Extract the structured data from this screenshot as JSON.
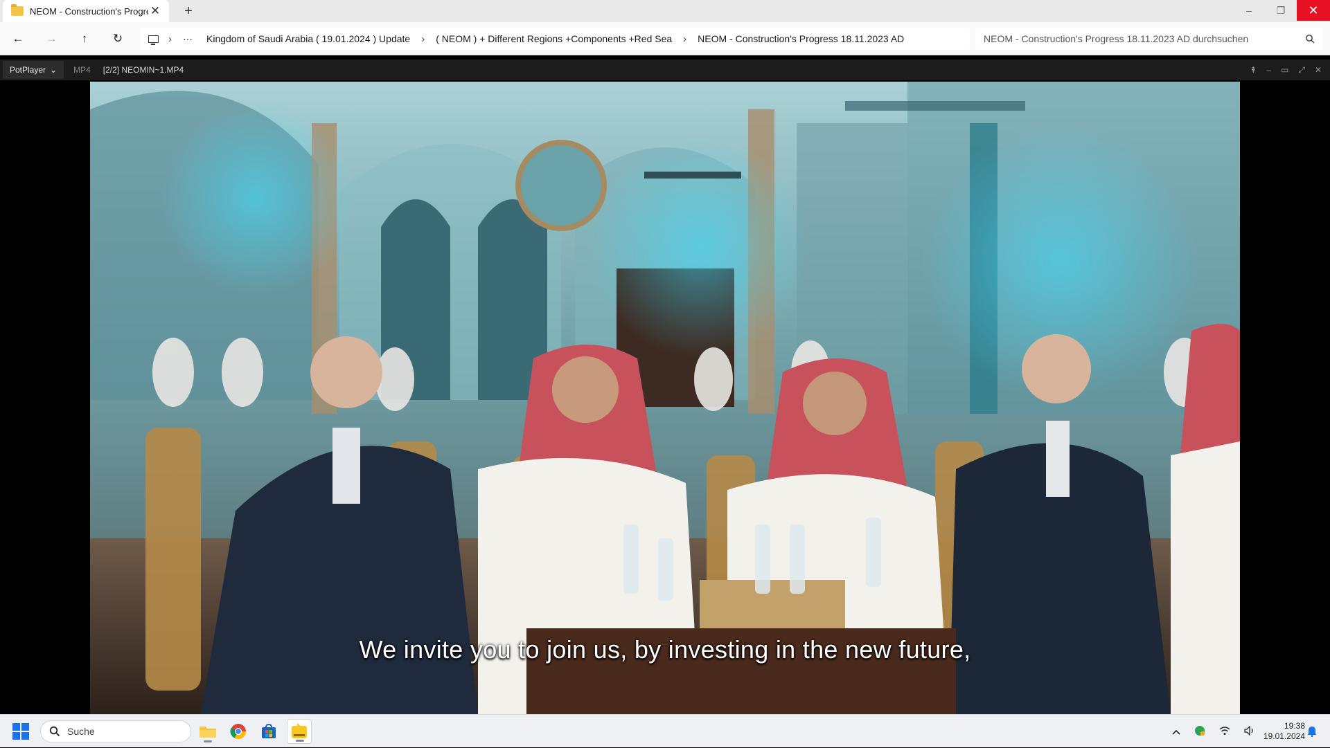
{
  "explorer": {
    "tab_title": "NEOM - Construction's Progre",
    "tab_close": "✕",
    "new_tab": "+",
    "window": {
      "minimize": "–",
      "maximize": "❐",
      "close": "✕"
    },
    "nav": {
      "back": "←",
      "forward": "→",
      "up": "↑",
      "refresh": "↻",
      "more": "···"
    },
    "breadcrumb": [
      "Kingdom of Saudi Arabia ( 19.01.2024 ) Update",
      "( NEOM ) + Different Regions +Components +Red Sea",
      "NEOM - Construction's Progress 18.11.2023 AD"
    ],
    "crumb_separator": "›",
    "search_placeholder": "NEOM - Construction's Progress 18.11.2023 AD durchsuchen"
  },
  "player": {
    "menu_label": "PotPlayer",
    "format": "MP4",
    "file": "[2/2] NEOMIN~1.MP4",
    "controls": [
      "⇞",
      "–",
      "▭",
      "⤢",
      "✕"
    ],
    "subtitle": "We invite you to join us, by investing in the new future,"
  },
  "taskbar": {
    "search_label": "Suche",
    "tray_icons": [
      "chevron-up-icon",
      "security-shield-icon",
      "wifi-icon",
      "speaker-icon"
    ],
    "time": "19:38",
    "date": "19.01.2024"
  },
  "colors": {
    "close_red": "#e81123",
    "start_blue": "#1a73e8",
    "folder_yellow": "#f4c542",
    "potplayer_yellow": "#f6c621"
  }
}
